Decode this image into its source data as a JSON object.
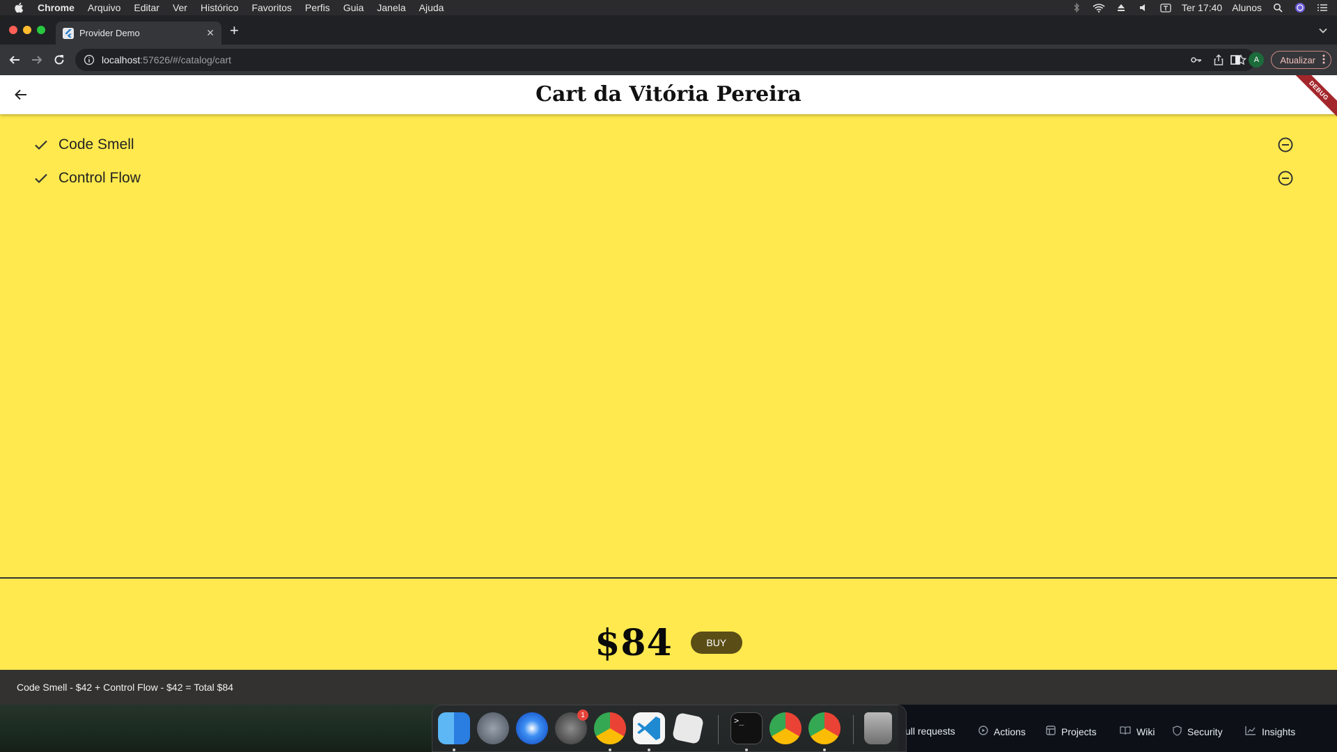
{
  "menubar": {
    "app": "Chrome",
    "items": [
      "Arquivo",
      "Editar",
      "Ver",
      "Histórico",
      "Favoritos",
      "Perfis",
      "Guia",
      "Janela",
      "Ajuda"
    ],
    "clock": "Ter 17:40",
    "user": "Alunos"
  },
  "browser": {
    "tab_title": "Provider Demo",
    "url_host": "localhost",
    "url_rest": ":57626/#/catalog/cart",
    "profile_initial": "A",
    "update_label": "Atualizar"
  },
  "app": {
    "title": "Cart da Vitória Pereira",
    "debug_banner": "DEBUG",
    "cart_items": [
      {
        "name": "Code Smell"
      },
      {
        "name": "Control Flow"
      }
    ],
    "total": "$84",
    "buy_label": "BUY",
    "snackbar": "Code Smell - $42 + Control Flow - $42 = Total $84"
  },
  "github_nav": [
    "ull requests",
    "Actions",
    "Projects",
    "Wiki",
    "Security",
    "Insights"
  ],
  "dock": {
    "apps": [
      "finder",
      "launchpad",
      "safari",
      "system-preferences",
      "chrome",
      "vscode",
      "roblox",
      "terminal",
      "chrome",
      "chrome",
      "trash"
    ],
    "system_preferences_badge": "1"
  },
  "colors": {
    "page_background": "#ffe94e",
    "buy_button": "#5a4d16",
    "snackbar": "#333231",
    "debug_banner": "#a3262b"
  }
}
